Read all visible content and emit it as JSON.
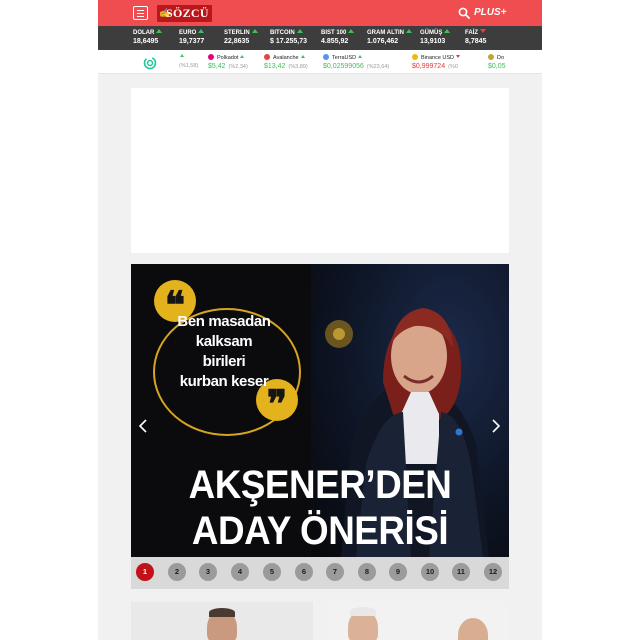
{
  "header": {
    "menu_icon": "hamburger-icon",
    "logo_mark": "✍",
    "logo_text": "SÖZCÜ",
    "search_icon": "search-icon",
    "plus_label": "PLUS+",
    "colors": {
      "bar": "#ef4d50",
      "logo_bg": "#b9171c"
    }
  },
  "markets": [
    {
      "label": "DOLAR",
      "value": "18,6495",
      "trend": "up"
    },
    {
      "label": "EURO",
      "value": "19,7377",
      "trend": "up"
    },
    {
      "label": "STERLIN",
      "value": "22,8635",
      "trend": "up"
    },
    {
      "label": "BITCOIN",
      "value": "$ 17.255,73",
      "trend": "up"
    },
    {
      "label": "BIST 100",
      "value": "4.855,92",
      "trend": "up"
    },
    {
      "label": "GRAM ALTIN",
      "value": "1.076,462",
      "trend": "up"
    },
    {
      "label": "GÜMÜŞ",
      "value": "13,9103",
      "trend": "up"
    },
    {
      "label": "FAİZ",
      "value": "8,7845",
      "trend": "down"
    }
  ],
  "crypto": [
    {
      "name": "",
      "price": "",
      "change": "(%1,58)",
      "trend": "up",
      "icon": "none"
    },
    {
      "name": "Polkadot",
      "price": "$5,42",
      "change": "(%2,34)",
      "trend": "up",
      "icon": "polkadot-icon",
      "color": "#e6007a"
    },
    {
      "name": "Avalanche",
      "price": "$13,42",
      "change": "(%3,89)",
      "trend": "up",
      "icon": "avalanche-icon",
      "color": "#e84142"
    },
    {
      "name": "TerraUSD",
      "price": "$0,02599056",
      "change": "(%23,64)",
      "trend": "up",
      "icon": "terrausd-icon",
      "color": "#5493f7"
    },
    {
      "name": "Binance USD",
      "price": "$0,999724",
      "change": "(%0",
      "trend": "down",
      "icon": "binance-usd-icon",
      "color": "#f0b90b"
    },
    {
      "name": "Do",
      "price": "$0,05",
      "change": "",
      "trend": "up",
      "icon": "dogecoin-icon",
      "color": "#c2a633"
    }
  ],
  "slider": {
    "quote_lines": [
      "Ben masadan",
      "kalksam",
      "birileri",
      "kurban keser"
    ],
    "headline_line1": "AKŞENER’DEN",
    "headline_line2": "ADAY ÖNERİSİ",
    "accent_color": "#d5a521",
    "active_page": 1,
    "pages": [
      "1",
      "2",
      "3",
      "4",
      "5",
      "6",
      "7",
      "8",
      "9",
      "10",
      "11",
      "12"
    ]
  }
}
